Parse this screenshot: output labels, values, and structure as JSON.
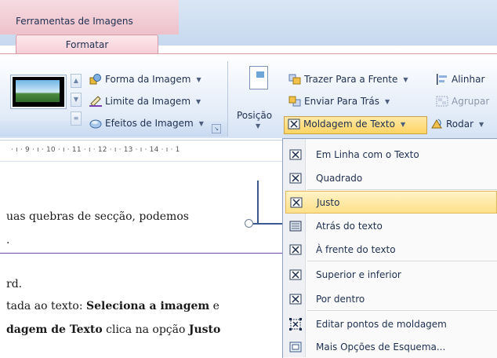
{
  "titlebar": {
    "contextual_tab_title": "Ferramentas de Imagens",
    "tab_label": "Formatar"
  },
  "ribbon": {
    "picture_styles": {
      "shape_label": "Forma da Imagem",
      "border_label": "Limite da Imagem",
      "effects_label": "Efeitos de Imagem"
    },
    "arrange": {
      "position_label": "Posição",
      "bring_front_label": "Trazer Para a Frente",
      "send_back_label": "Enviar Para Trás",
      "text_wrap_label": "Moldagem de Texto",
      "align_label": "Alinhar",
      "group_label": "Agrupar",
      "rotate_label": "Rodar"
    }
  },
  "ruler": {
    "text": "· ı · 9 · ı · 10 · ı · 11 · ı · 12 · ı · 13 · ı · 14 · ı · 1"
  },
  "document": {
    "line1": "uas quebras de secção, podemos",
    "line2": ".",
    "line3": "rd.",
    "line4_normal": "tada ao texto: ",
    "line4_bold": "Seleciona a imagem",
    "line4_tail": " e",
    "line5_bold": "dagem de Texto",
    "line5_normal": " clica na opção ",
    "line5_bold2": "Justo"
  },
  "wrap_menu": {
    "items": [
      {
        "label": "Em Linha com o Texto",
        "icon": "wrap-inline-icon"
      },
      {
        "label": "Quadrado",
        "icon": "wrap-square-icon"
      },
      {
        "label": "Justo",
        "icon": "wrap-tight-icon",
        "highlighted": true
      },
      {
        "label": "Atrás do texto",
        "icon": "wrap-behind-icon"
      },
      {
        "label": "À frente do texto",
        "icon": "wrap-front-icon"
      },
      {
        "label": "Superior e inferior",
        "icon": "wrap-top-bottom-icon"
      },
      {
        "label": "Por dentro",
        "icon": "wrap-through-icon"
      },
      {
        "label": "Editar pontos de moldagem",
        "icon": "edit-wrap-points-icon"
      },
      {
        "label": "Mais Opções de Esquema...",
        "icon": "more-layout-options-icon"
      }
    ]
  },
  "colors": {
    "accent_highlight": "#ffd463",
    "contextual_tab": "#eec1cb",
    "ribbon_blue": "#d6e3f4"
  }
}
